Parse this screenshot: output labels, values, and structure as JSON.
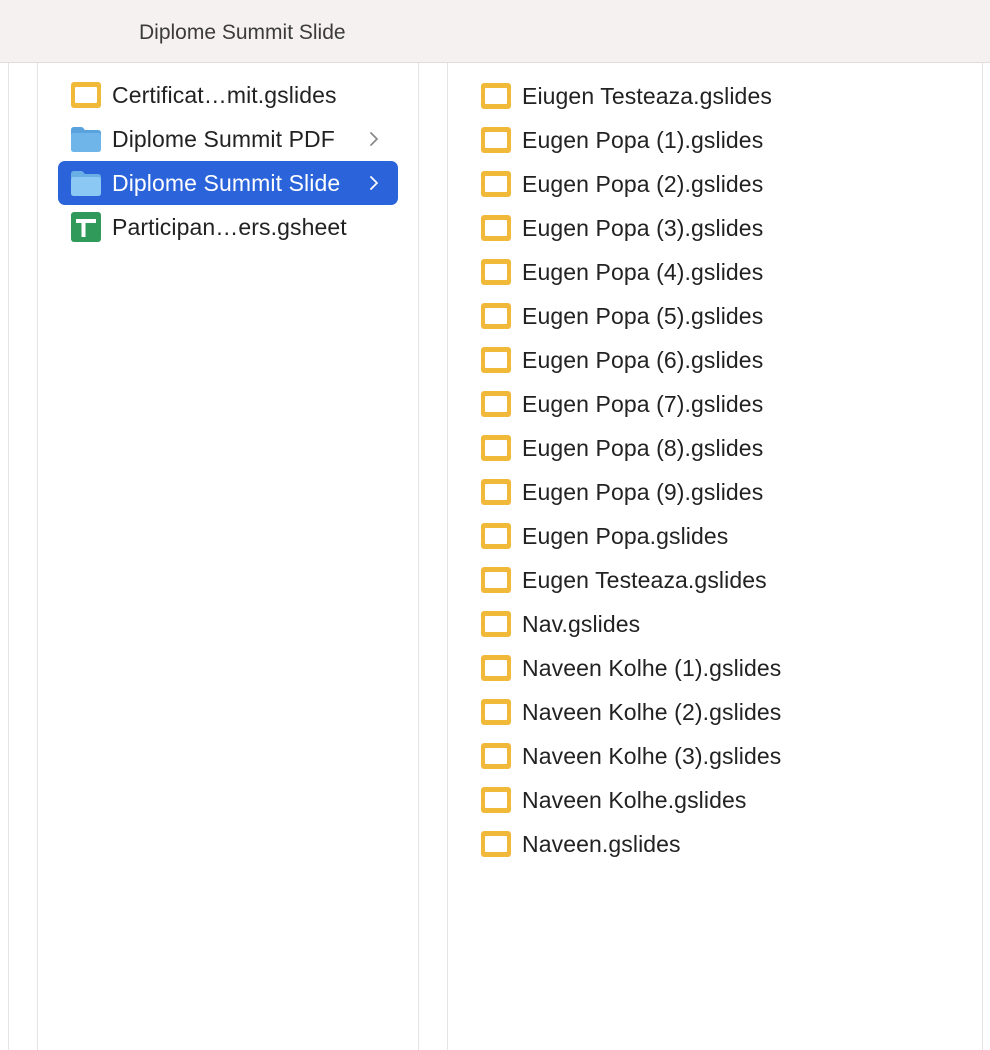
{
  "window": {
    "title": "Diplome Summit Slide"
  },
  "colors": {
    "selection": "#2a63da",
    "slides_icon": "#f0b93a",
    "folder_icon": "#6fb5ea",
    "sheets_icon": "#2f9a5a"
  },
  "left_column": {
    "items": [
      {
        "label": "Certificat…mit.gslides",
        "icon": "slides-icon",
        "has_children": false,
        "selected": false
      },
      {
        "label": "Diplome Summit PDF",
        "icon": "folder-icon",
        "has_children": true,
        "selected": false
      },
      {
        "label": "Diplome Summit Slide",
        "icon": "folder-icon",
        "has_children": true,
        "selected": true
      },
      {
        "label": "Participan…ers.gsheet",
        "icon": "sheets-icon",
        "has_children": false,
        "selected": false
      }
    ]
  },
  "right_column": {
    "items": [
      {
        "label": "Eiugen Testeaza.gslides",
        "icon": "slides-icon"
      },
      {
        "label": "Eugen Popa (1).gslides",
        "icon": "slides-icon"
      },
      {
        "label": "Eugen Popa (2).gslides",
        "icon": "slides-icon"
      },
      {
        "label": "Eugen Popa (3).gslides",
        "icon": "slides-icon"
      },
      {
        "label": "Eugen Popa (4).gslides",
        "icon": "slides-icon"
      },
      {
        "label": "Eugen Popa (5).gslides",
        "icon": "slides-icon"
      },
      {
        "label": "Eugen Popa (6).gslides",
        "icon": "slides-icon"
      },
      {
        "label": "Eugen Popa (7).gslides",
        "icon": "slides-icon"
      },
      {
        "label": "Eugen Popa (8).gslides",
        "icon": "slides-icon"
      },
      {
        "label": "Eugen Popa (9).gslides",
        "icon": "slides-icon"
      },
      {
        "label": "Eugen Popa.gslides",
        "icon": "slides-icon"
      },
      {
        "label": "Eugen Testeaza.gslides",
        "icon": "slides-icon"
      },
      {
        "label": "Nav.gslides",
        "icon": "slides-icon"
      },
      {
        "label": "Naveen Kolhe (1).gslides",
        "icon": "slides-icon"
      },
      {
        "label": "Naveen Kolhe (2).gslides",
        "icon": "slides-icon"
      },
      {
        "label": "Naveen Kolhe (3).gslides",
        "icon": "slides-icon"
      },
      {
        "label": "Naveen Kolhe.gslides",
        "icon": "slides-icon"
      },
      {
        "label": "Naveen.gslides",
        "icon": "slides-icon"
      }
    ]
  }
}
